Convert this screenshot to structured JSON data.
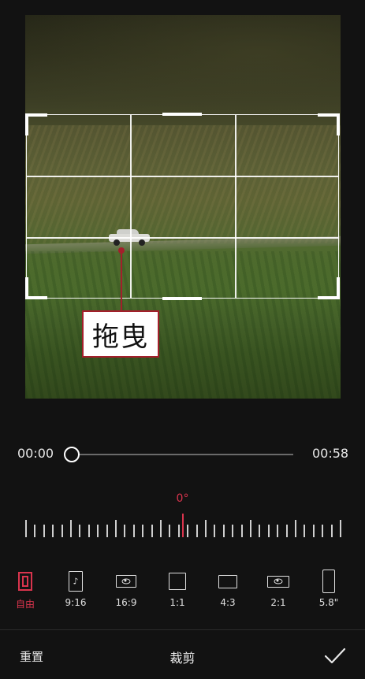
{
  "annotation": {
    "label": "拖曳"
  },
  "timeline": {
    "start": "00:00",
    "end": "00:58",
    "progress": 0.0
  },
  "rotation": {
    "value": "0°"
  },
  "ratios": [
    {
      "id": "free",
      "label": "自由",
      "active": true
    },
    {
      "id": "9-16",
      "label": "9:16",
      "icon": "tiktok-frame-icon"
    },
    {
      "id": "16-9",
      "label": "16:9",
      "icon": "youtube-frame-icon"
    },
    {
      "id": "1-1",
      "label": "1:1"
    },
    {
      "id": "4-3",
      "label": "4:3"
    },
    {
      "id": "2-1",
      "label": "2:1",
      "icon": "youtube-frame-icon"
    },
    {
      "id": "5-8",
      "label": "5.8\""
    }
  ],
  "bottom_bar": {
    "reset": "重置",
    "title": "裁剪",
    "confirm_icon": "checkmark-icon"
  },
  "colors": {
    "accent": "#d9344d",
    "annotation": "#a31f2b",
    "background": "#121212"
  }
}
